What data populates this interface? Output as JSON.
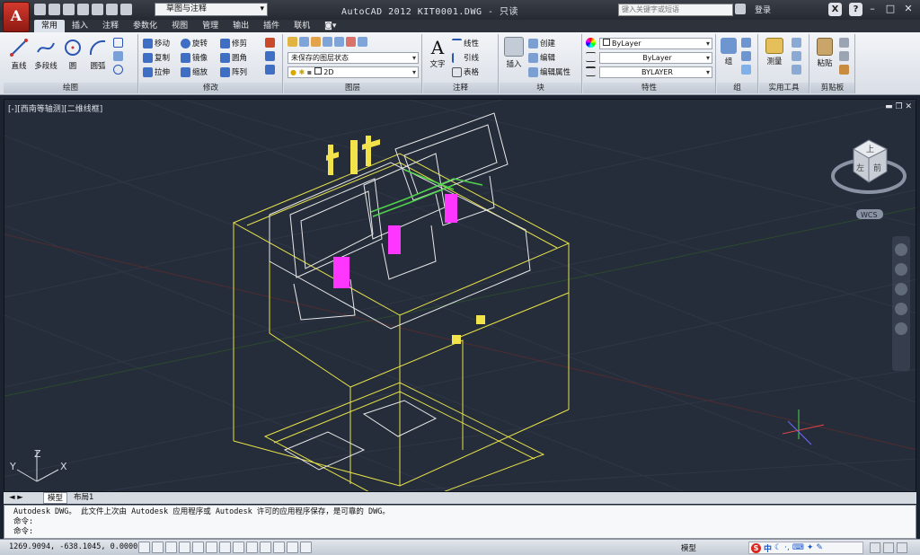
{
  "app": {
    "logo_letter": "A",
    "workspace": "草图与注释",
    "title": "AutoCAD 2012    KIT0001.DWG - 只读",
    "search_placeholder": "键入关键字或短语",
    "login": "登录"
  },
  "tabs": [
    "常用",
    "插入",
    "注释",
    "参数化",
    "视图",
    "管理",
    "输出",
    "插件",
    "联机"
  ],
  "active_tab": "常用",
  "ribbon": {
    "draw": {
      "label": "绘图",
      "tools": [
        "直线",
        "多段线",
        "圆",
        "圆弧"
      ]
    },
    "modify": {
      "label": "修改",
      "tools": [
        "移动",
        "旋转",
        "修剪",
        "复制",
        "镜像",
        "圆角",
        "拉伸",
        "缩放",
        "阵列"
      ]
    },
    "layer": {
      "label": "图层",
      "state": "未保存的图层状态",
      "current": "2D"
    },
    "annotation": {
      "label": "注释",
      "big_tool": "文字",
      "tools": [
        "线性",
        "引线",
        "表格"
      ]
    },
    "block": {
      "label": "块",
      "big_tool": "插入",
      "tools": [
        "创建",
        "编辑",
        "编辑属性"
      ]
    },
    "properties": {
      "label": "特性",
      "color": "ByLayer",
      "linetype": "ByLayer",
      "lineweight": "BYLAYER"
    },
    "groups": {
      "label": "组",
      "big_tool": "组"
    },
    "utilities": {
      "label": "实用工具",
      "big_tool": "测量"
    },
    "clipboard": {
      "label": "剪贴板",
      "big_tool": "粘贴"
    }
  },
  "viewport": {
    "label": "[-][西南等轴测][二维线框]",
    "viewcube": {
      "top": "上",
      "left": "左",
      "front": "前"
    },
    "wcs": "WCS"
  },
  "layout_tabs": [
    "模型",
    "布局1"
  ],
  "command": {
    "line1": "Autodesk DWG。  此文件上次由 Autodesk 应用程序或 Autodesk 许可的应用程序保存，是可靠的 DWG。",
    "line2": "命令:",
    "line3": "命令:"
  },
  "status": {
    "coords": "1269.9094, -638.1045, 0.0000",
    "model": "模型",
    "ime": "中"
  },
  "colors": {
    "title_bg": "#2b3038",
    "viewport_bg": "#252c3a",
    "wire_yellow": "#e8e34a",
    "wire_white": "#e8e8e8",
    "wire_magenta": "#ff36ff",
    "wire_green": "#4fd34a"
  }
}
